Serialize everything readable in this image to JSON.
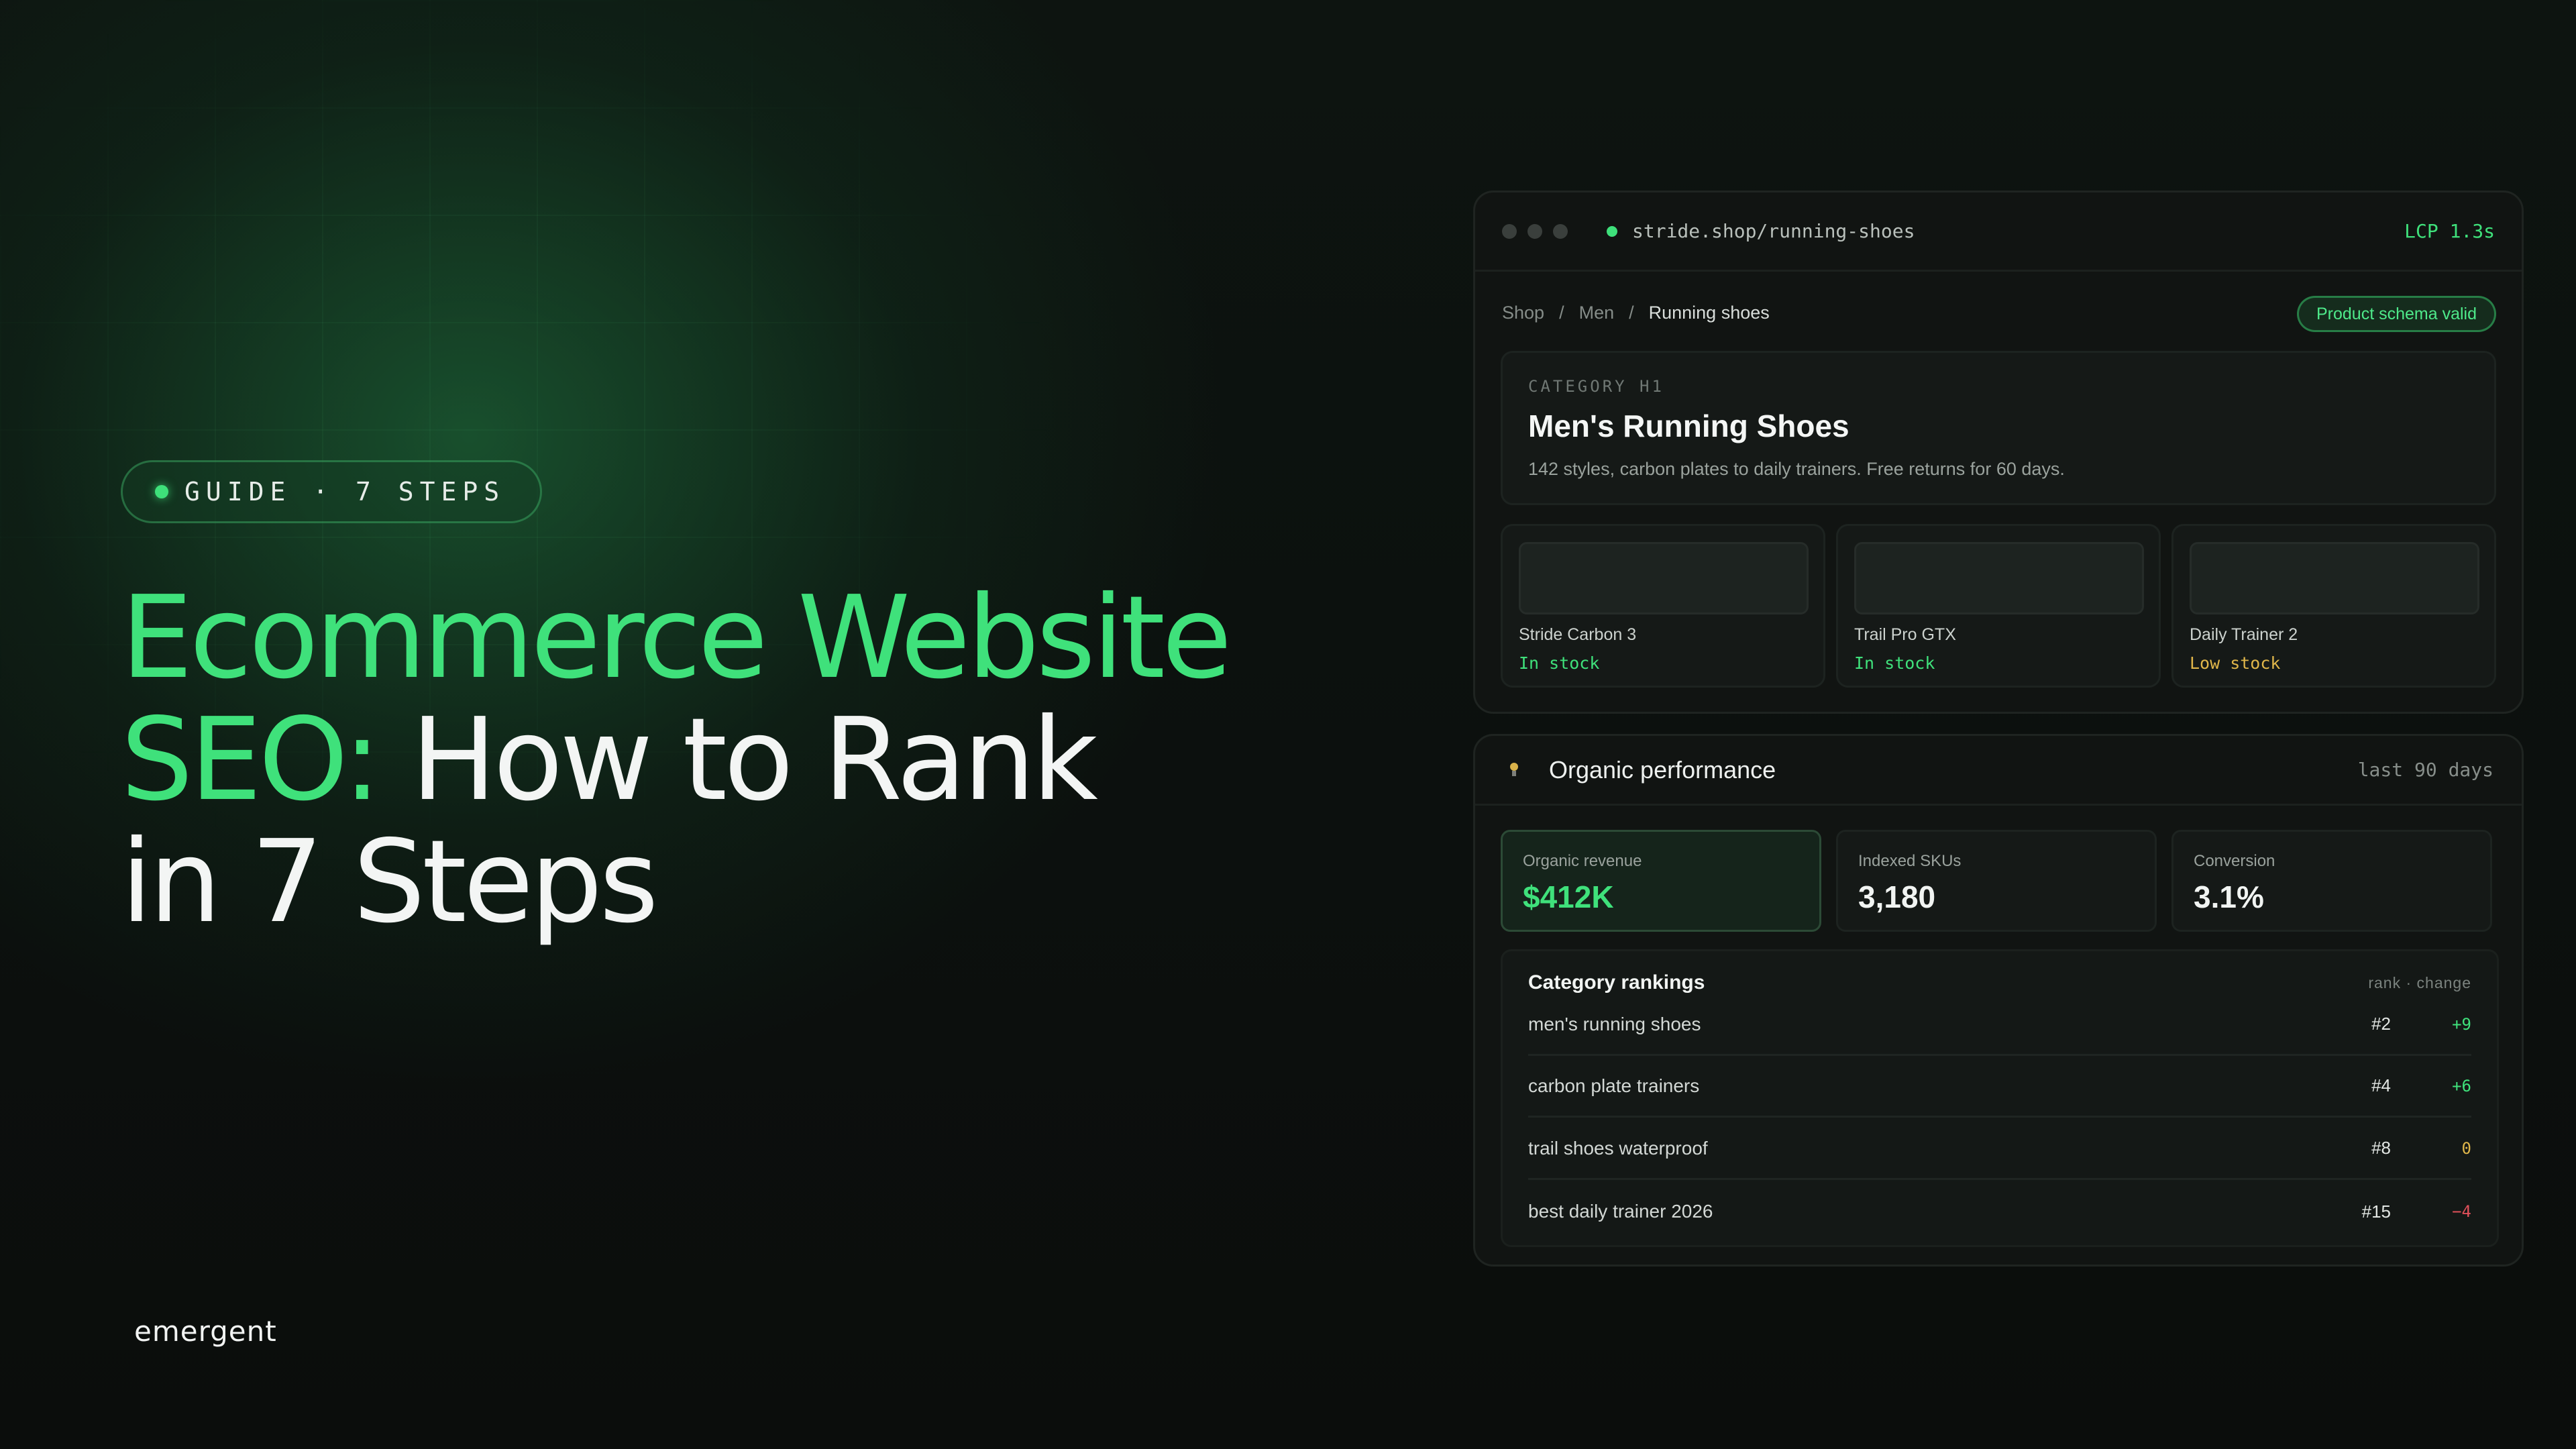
{
  "hero": {
    "badge": "GUIDE · 7 STEPS",
    "title_accent_1": "Ecommerce Website",
    "title_accent_2": "SEO:",
    "title_rest_1": "How to Rank",
    "title_rest_2": "in 7 Steps",
    "logo": "emergent"
  },
  "browser": {
    "url": "stride.shop/running-shoes",
    "lcp": "LCP 1.3s",
    "breadcrumbs": [
      "Shop",
      "/",
      "Men",
      "/",
      "Running shoes"
    ],
    "schema_badge": "Product schema valid",
    "h1_label": "CATEGORY H1",
    "h1_title": "Men's Running Shoes",
    "h1_desc": "142 styles, carbon plates to daily trainers. Free returns for 60 days.",
    "products": [
      {
        "name": "Stride Carbon 3",
        "stock": "In stock",
        "stock_color": "#3fe17b"
      },
      {
        "name": "Trail Pro GTX",
        "stock": "In stock",
        "stock_color": "#3fe17b"
      },
      {
        "name": "Daily Trainer 2",
        "stock": "Low stock",
        "stock_color": "#e0b64a"
      }
    ]
  },
  "performance": {
    "title": "Organic performance",
    "range": "last 90 days",
    "icon": "lightbulb-icon",
    "metrics": [
      {
        "label": "Organic revenue",
        "value": "$412K"
      },
      {
        "label": "Indexed SKUs",
        "value": "3,180"
      },
      {
        "label": "Conversion",
        "value": "3.1%"
      }
    ],
    "rankings": {
      "title": "Category rankings",
      "columns": "rank · change",
      "rows": [
        {
          "keyword": "men's running shoes",
          "rank": "#2",
          "change": "+9",
          "change_color": "#3fe17b"
        },
        {
          "keyword": "carbon plate trainers",
          "rank": "#4",
          "change": "+6",
          "change_color": "#3fe17b"
        },
        {
          "keyword": "trail shoes waterproof",
          "rank": "#8",
          "change": "0",
          "change_color": "#e0b64a"
        },
        {
          "keyword": "best daily trainer 2026",
          "rank": "#15",
          "change": "−4",
          "change_color": "#e0505a"
        }
      ]
    }
  },
  "colors": {
    "accent": "#3fe17b",
    "background": "#0b0d0c",
    "warning": "#e0b64a",
    "negative": "#e0505a"
  }
}
